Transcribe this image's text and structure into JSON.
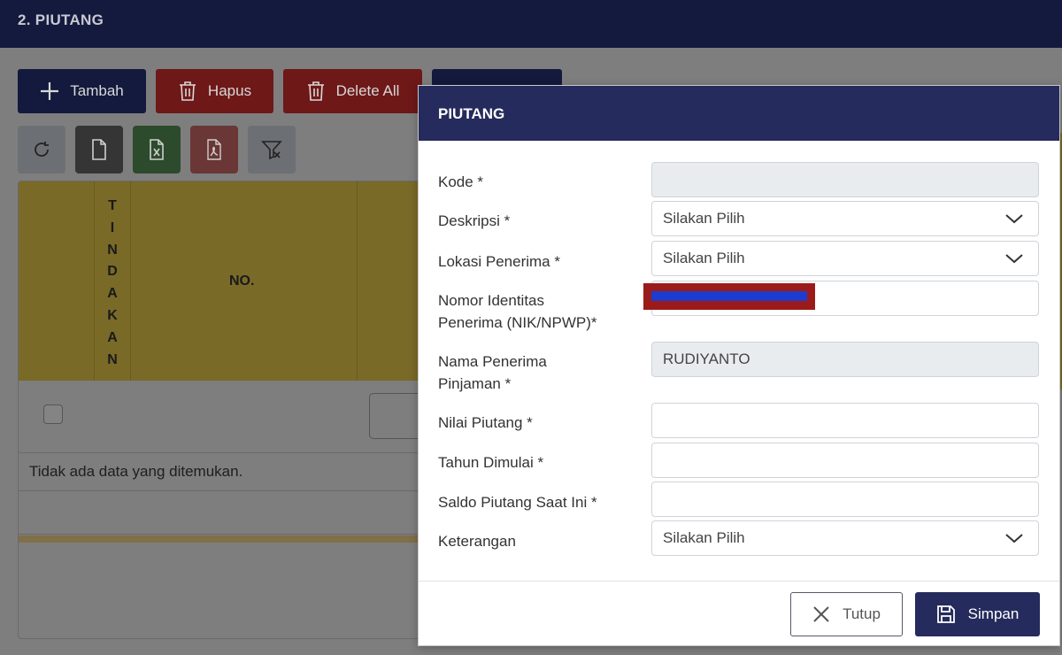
{
  "page": {
    "title": "2. PIUTANG"
  },
  "toolbar": {
    "tambah_label": "Tambah",
    "hapus_label": "Hapus",
    "delete_all_label": "Delete All"
  },
  "table": {
    "header_tindakan": [
      "T",
      "I",
      "N",
      "D",
      "A",
      "K",
      "A",
      "N"
    ],
    "header_no": "NO.",
    "empty_message": "Tidak ada data yang ditemukan."
  },
  "modal": {
    "title": "PIUTANG",
    "fields": {
      "kode": {
        "label": "Kode *",
        "value": ""
      },
      "deskripsi": {
        "label": "Deskripsi *",
        "value": "Silakan Pilih"
      },
      "lokasi": {
        "label": "Lokasi Penerima *",
        "value": "Silakan Pilih"
      },
      "nik": {
        "label_line1": "Nomor Identitas",
        "label_line2": "Penerima (NIK/NPWP)*",
        "value": ""
      },
      "nama": {
        "label_line1": "Nama Penerima",
        "label_line2": "Pinjaman *",
        "value": "RUDIYANTO"
      },
      "nilai": {
        "label": "Nilai Piutang *",
        "value": ""
      },
      "tahun": {
        "label": "Tahun Dimulai *",
        "value": ""
      },
      "saldo": {
        "label": "Saldo Piutang Saat Ini *",
        "value": ""
      },
      "keterangan": {
        "label": "Keterangan",
        "value": "Silakan Pilih"
      }
    },
    "buttons": {
      "tutup": "Tutup",
      "simpan": "Simpan"
    }
  },
  "colors": {
    "header_navy": "#141a3d",
    "modal_header": "#252b5c",
    "danger": "#6e1818",
    "table_header_yellow": "#7a6a28",
    "redaction_red": "#9b1b1b",
    "redaction_blue": "#1d3ccf"
  },
  "icons": [
    "plus-icon",
    "trash-icon",
    "refresh-icon",
    "file-icon",
    "excel-icon",
    "pdf-icon",
    "filter-icon",
    "chevron-down-icon",
    "close-icon",
    "save-icon"
  ]
}
